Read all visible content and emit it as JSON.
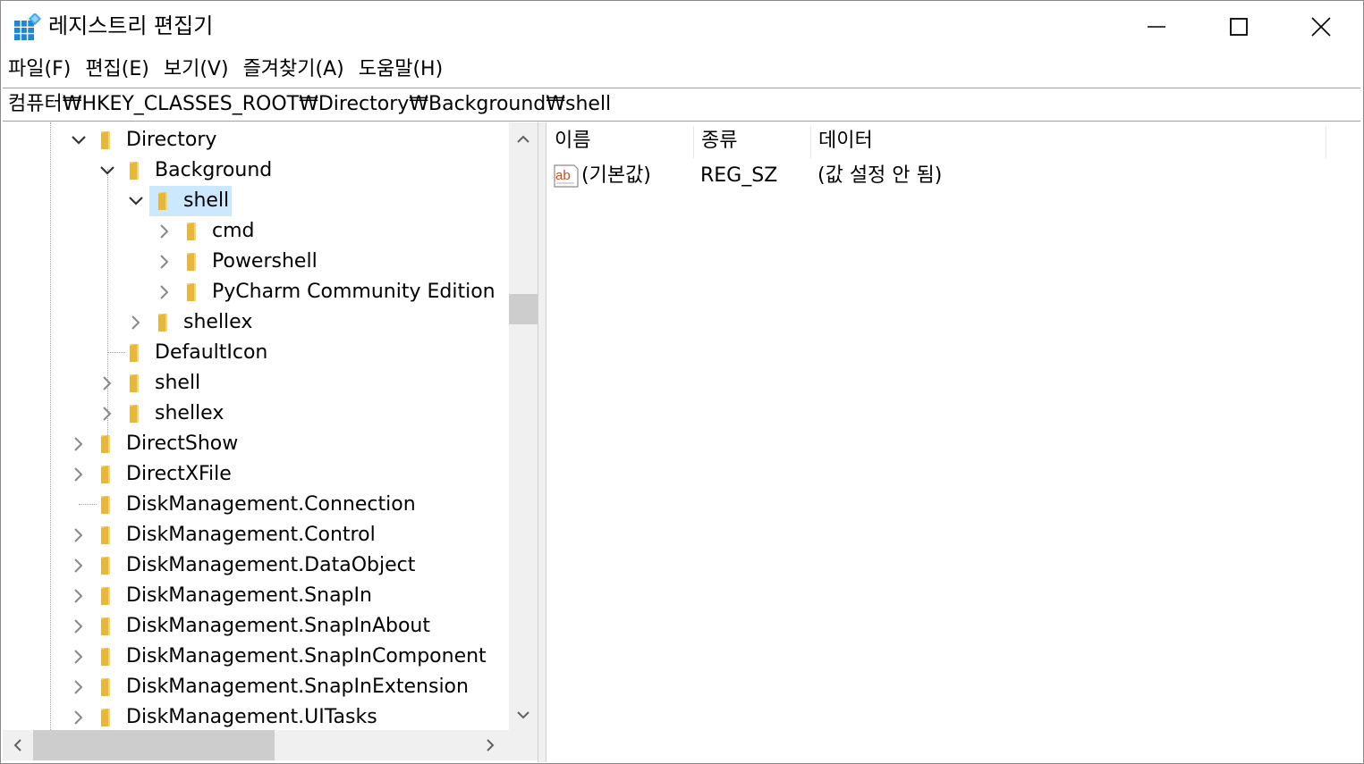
{
  "window": {
    "title": "레지스트리 편집기",
    "icon": "registry-editor-icon"
  },
  "menu": {
    "items": [
      "파일(F)",
      "편집(E)",
      "보기(V)",
      "즐겨찾기(A)",
      "도움말(H)"
    ]
  },
  "address": {
    "path": "컴퓨터₩HKEY_CLASSES_ROOT₩Directory₩Background₩shell"
  },
  "tree": {
    "items": [
      {
        "label": "Directory",
        "expanded": true,
        "selected": false
      },
      {
        "label": "Background",
        "expanded": true,
        "selected": false
      },
      {
        "label": "shell",
        "expanded": true,
        "selected": true
      },
      {
        "label": "cmd",
        "expanded": false,
        "selected": false
      },
      {
        "label": "Powershell",
        "expanded": false,
        "selected": false
      },
      {
        "label": "PyCharm Community Edition",
        "expanded": false,
        "selected": false
      },
      {
        "label": "shellex",
        "expanded": false,
        "selected": false
      },
      {
        "label": "DefaultIcon",
        "expanded": false,
        "selected": false
      },
      {
        "label": "shell",
        "expanded": false,
        "selected": false
      },
      {
        "label": "shellex",
        "expanded": false,
        "selected": false
      },
      {
        "label": "DirectShow",
        "expanded": false,
        "selected": false
      },
      {
        "label": "DirectXFile",
        "expanded": false,
        "selected": false
      },
      {
        "label": "DiskManagement.Connection",
        "expanded": false,
        "selected": false
      },
      {
        "label": "DiskManagement.Control",
        "expanded": false,
        "selected": false
      },
      {
        "label": "DiskManagement.DataObject",
        "expanded": false,
        "selected": false
      },
      {
        "label": "DiskManagement.SnapIn",
        "expanded": false,
        "selected": false
      },
      {
        "label": "DiskManagement.SnapInAbout",
        "expanded": false,
        "selected": false
      },
      {
        "label": "DiskManagement.SnapInComponent",
        "expanded": false,
        "selected": false
      },
      {
        "label": "DiskManagement.SnapInExtension",
        "expanded": false,
        "selected": false
      },
      {
        "label": "DiskManagement.UITasks",
        "expanded": false,
        "selected": false
      }
    ]
  },
  "list": {
    "columns": [
      "이름",
      "종류",
      "데이터"
    ],
    "rows": [
      {
        "name": "(기본값)",
        "type": "REG_SZ",
        "data": "(값 설정 안 됨)",
        "icon": "string-value-icon"
      }
    ]
  },
  "colors": {
    "selection": "#cce8ff",
    "folder": "#f8d775",
    "scrollbar_track": "#f0f0f0",
    "scrollbar_thumb": "#cdcdcd"
  }
}
